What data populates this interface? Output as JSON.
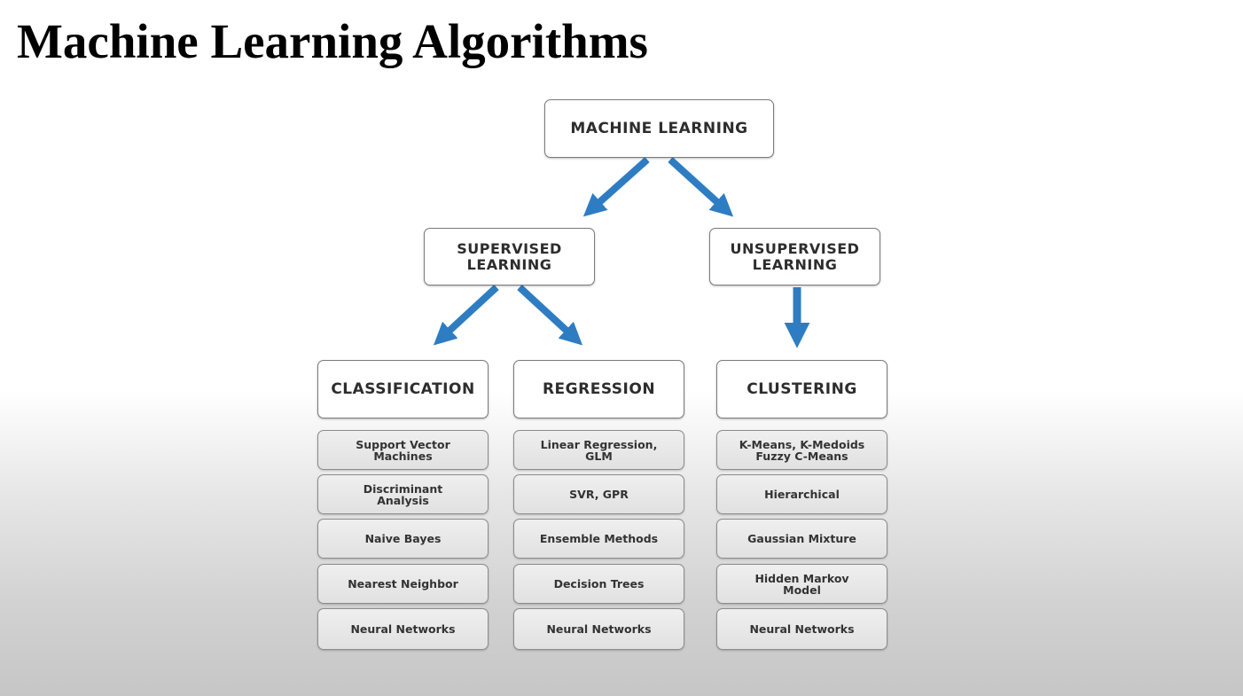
{
  "slide": {
    "title": "Machine Learning Algorithms"
  },
  "diagram": {
    "root": {
      "label": "MACHINE LEARNING"
    },
    "supervised": {
      "label_line1": "SUPERVISED",
      "label_line2": "LEARNING"
    },
    "unsupervised": {
      "label_line1": "UNSUPERVISED",
      "label_line2": "LEARNING"
    },
    "classification": {
      "label": "CLASSIFICATION",
      "items": [
        {
          "line1": "Support Vector",
          "line2": "Machines"
        },
        {
          "line1": "Discriminant",
          "line2": "Analysis"
        },
        {
          "line1": "Naive Bayes",
          "line2": ""
        },
        {
          "line1": "Nearest Neighbor",
          "line2": ""
        },
        {
          "line1": "Neural Networks",
          "line2": ""
        }
      ]
    },
    "regression": {
      "label": "REGRESSION",
      "items": [
        {
          "line1": "Linear Regression,",
          "line2": "GLM"
        },
        {
          "line1": "SVR, GPR",
          "line2": ""
        },
        {
          "line1": "Ensemble Methods",
          "line2": ""
        },
        {
          "line1": "Decision Trees",
          "line2": ""
        },
        {
          "line1": "Neural Networks",
          "line2": ""
        }
      ]
    },
    "clustering": {
      "label": "CLUSTERING",
      "items": [
        {
          "line1": "K-Means, K-Medoids",
          "line2": "Fuzzy C-Means"
        },
        {
          "line1": "Hierarchical",
          "line2": ""
        },
        {
          "line1": "Gaussian Mixture",
          "line2": ""
        },
        {
          "line1": "Hidden Markov",
          "line2": "Model"
        },
        {
          "line1": "Neural Networks",
          "line2": ""
        }
      ]
    },
    "colors": {
      "arrow": "#2e7dc2",
      "border": "#7b7b7b",
      "text": "#2d2d2d"
    }
  }
}
